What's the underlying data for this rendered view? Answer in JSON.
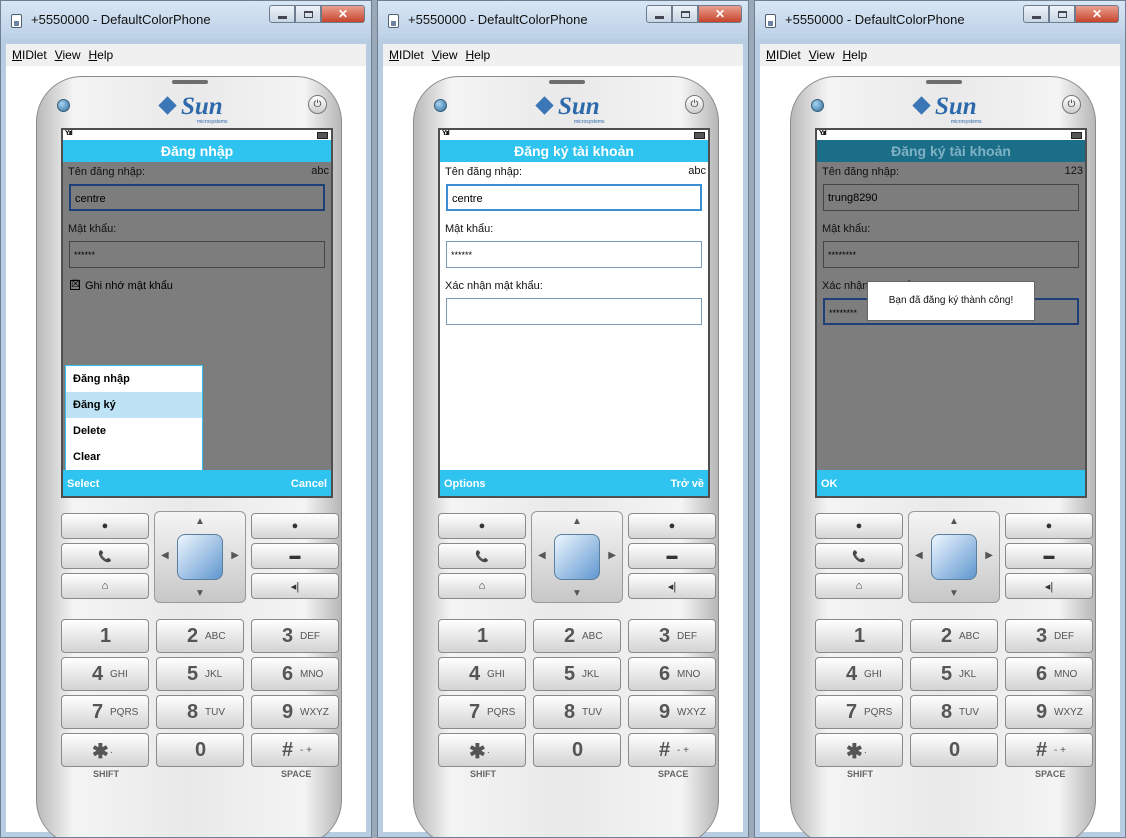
{
  "windows": [
    {
      "title": "+5550000 - DefaultColorPhone",
      "menu": [
        "MIDlet",
        "View",
        "Help"
      ],
      "screen": {
        "header": "Đăng nhập",
        "username_label": "Tên đăng nhập:",
        "input_mode": "abc",
        "username_value": "centre",
        "password_label": "Mật khẩu:",
        "password_value": "******",
        "remember_label": "Ghi nhớ mật khẩu",
        "remember_mark": "☒",
        "popup_menu": [
          "Đăng nhập",
          "Đăng ký",
          "Delete",
          "Clear"
        ],
        "soft_left": "Select",
        "soft_right": "Cancel"
      }
    },
    {
      "title": "+5550000 - DefaultColorPhone",
      "menu": [
        "MIDlet",
        "View",
        "Help"
      ],
      "screen": {
        "header": "Đăng ký tài khoản",
        "username_label": "Tên đăng nhập:",
        "input_mode": "abc",
        "username_value": "centre",
        "password_label": "Mật khẩu:",
        "password_value": "******",
        "confirm_label": "Xác nhận mật khẩu:",
        "confirm_value": "",
        "soft_left": "Options",
        "soft_right": "Trở về"
      }
    },
    {
      "title": "+5550000 - DefaultColorPhone",
      "menu": [
        "MIDlet",
        "View",
        "Help"
      ],
      "screen": {
        "header": "Đăng ký tài khoản",
        "username_label": "Tên đăng nhập:",
        "input_mode": "123",
        "username_value": "trung8290",
        "password_label": "Mật khẩu:",
        "password_value": "********",
        "confirm_label": "Xác nhận mật khẩu:",
        "confirm_value": "********",
        "alert": "Bạn đã đăng ký thành công!",
        "soft_left": "OK"
      }
    }
  ],
  "phone": {
    "brand": "Sun",
    "brand_sub": "microsystems",
    "keys": [
      {
        "digit": "1",
        "letters": ""
      },
      {
        "digit": "2",
        "letters": "ABC"
      },
      {
        "digit": "3",
        "letters": "DEF"
      },
      {
        "digit": "4",
        "letters": "GHI"
      },
      {
        "digit": "5",
        "letters": "JKL"
      },
      {
        "digit": "6",
        "letters": "MNO"
      },
      {
        "digit": "7",
        "letters": "PQRS"
      },
      {
        "digit": "8",
        "letters": "TUV"
      },
      {
        "digit": "9",
        "letters": "WXYZ"
      },
      {
        "digit": "✱",
        "letters": "."
      },
      {
        "digit": "0",
        "letters": ""
      },
      {
        "digit": "#",
        "letters": "- +"
      }
    ],
    "shift_label": "SHIFT",
    "space_label": "SPACE"
  },
  "colors": {
    "softbar": "#2fc3ef",
    "header": "#2fc3ef",
    "header_dim": "#1b6e88"
  }
}
